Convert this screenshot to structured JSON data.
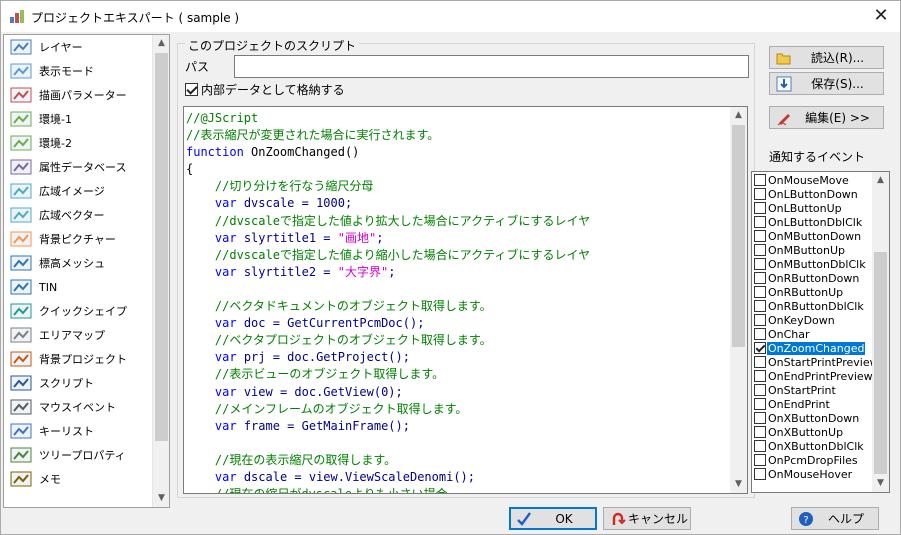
{
  "window": {
    "title": "プロジェクトエキスパート ( sample )"
  },
  "nav": {
    "items": [
      {
        "label": "レイヤー",
        "icon": "layer-icon"
      },
      {
        "label": "表示モード",
        "icon": "display-mode-icon"
      },
      {
        "label": "描画パラメーター",
        "icon": "draw-params-icon"
      },
      {
        "label": "環境-1",
        "icon": "environment-icon"
      },
      {
        "label": "環境-2",
        "icon": "environment-icon"
      },
      {
        "label": "属性データベース",
        "icon": "attribute-db-icon"
      },
      {
        "label": "広域イメージ",
        "icon": "wide-image-icon"
      },
      {
        "label": "広域ベクター",
        "icon": "wide-vector-icon"
      },
      {
        "label": "背景ピクチャー",
        "icon": "background-picture-icon"
      },
      {
        "label": "標高メッシュ",
        "icon": "elevation-mesh-icon"
      },
      {
        "label": "TIN",
        "icon": "tin-icon"
      },
      {
        "label": "クイックシェイプ",
        "icon": "quick-shape-icon"
      },
      {
        "label": "エリアマップ",
        "icon": "area-map-icon"
      },
      {
        "label": "背景プロジェクト",
        "icon": "background-project-icon"
      },
      {
        "label": "スクリプト",
        "icon": "script-icon",
        "selected": true
      },
      {
        "label": "マウスイベント",
        "icon": "mouse-icon"
      },
      {
        "label": "キーリスト",
        "icon": "key-list-icon"
      },
      {
        "label": "ツリープロパティ",
        "icon": "tree-property-icon"
      },
      {
        "label": "メモ",
        "icon": "memo-icon"
      }
    ]
  },
  "script_group": {
    "legend": "このプロジェクトのスクリプト",
    "path_label": "パス",
    "path_value": "",
    "store_internal_label": "内部データとして格納する",
    "store_internal_checked": true
  },
  "code": [
    [
      [
        "//@JScript",
        "green"
      ]
    ],
    [
      [
        "//表示縮尺が変更された場合に実行されます。",
        "green"
      ]
    ],
    [
      [
        "function",
        "blue"
      ],
      [
        " OnZoomChanged()",
        "black"
      ]
    ],
    [
      [
        "{",
        "black"
      ]
    ],
    [
      [
        "    //切り分けを行なう縮尺分母",
        "green"
      ]
    ],
    [
      [
        "    ",
        "black"
      ],
      [
        "var",
        "blue"
      ],
      [
        " dvscale = ",
        "darkblue"
      ],
      [
        "1000",
        "darkblue"
      ],
      [
        ";",
        "darkblue"
      ]
    ],
    [
      [
        "    //dvscaleで指定した値より拡大した場合にアクティブにするレイヤ",
        "green"
      ]
    ],
    [
      [
        "    ",
        "black"
      ],
      [
        "var",
        "blue"
      ],
      [
        " slyrtitle1 = ",
        "darkblue"
      ],
      [
        "\"画地\"",
        "magenta"
      ],
      [
        ";",
        "darkblue"
      ]
    ],
    [
      [
        "    //dvscaleで指定した値より縮小した場合にアクティブにするレイヤ",
        "green"
      ]
    ],
    [
      [
        "    ",
        "black"
      ],
      [
        "var",
        "blue"
      ],
      [
        " slyrtitle2 = ",
        "darkblue"
      ],
      [
        "\"大字界\"",
        "magenta"
      ],
      [
        ";",
        "darkblue"
      ]
    ],
    [
      [
        "",
        "black"
      ]
    ],
    [
      [
        "    //ベクタドキュメントのオブジェクト取得します。",
        "green"
      ]
    ],
    [
      [
        "    ",
        "black"
      ],
      [
        "var",
        "blue"
      ],
      [
        " doc = GetCurrentPcmDoc();",
        "darkblue"
      ]
    ],
    [
      [
        "    //ベクタプロジェクトのオブジェクト取得します。",
        "green"
      ]
    ],
    [
      [
        "    ",
        "black"
      ],
      [
        "var",
        "blue"
      ],
      [
        " prj = doc.GetProject();",
        "darkblue"
      ]
    ],
    [
      [
        "    //表示ビューのオブジェクト取得します。",
        "green"
      ]
    ],
    [
      [
        "    ",
        "black"
      ],
      [
        "var",
        "blue"
      ],
      [
        " view = doc.GetView(0);",
        "darkblue"
      ]
    ],
    [
      [
        "    //メインフレームのオブジェクト取得します。",
        "green"
      ]
    ],
    [
      [
        "    ",
        "black"
      ],
      [
        "var",
        "blue"
      ],
      [
        " frame = GetMainFrame();",
        "darkblue"
      ]
    ],
    [
      [
        "",
        "black"
      ]
    ],
    [
      [
        "    //現在の表示縮尺の取得します。",
        "green"
      ]
    ],
    [
      [
        "    ",
        "black"
      ],
      [
        "var",
        "blue"
      ],
      [
        " dscale = view.ViewScaleDenomi();",
        "darkblue"
      ]
    ],
    [
      [
        "    //現在の縮尺がdvscaleよりも小さい場合",
        "green"
      ]
    ]
  ],
  "buttons": {
    "load": "読込(R)...",
    "save": "保存(S)...",
    "edit": "編集(E) >>",
    "ok": "OK",
    "cancel": "キャンセル",
    "help": "ヘルプ"
  },
  "events": {
    "label": "通知するイベント",
    "items": [
      {
        "name": "OnMouseMove",
        "checked": false
      },
      {
        "name": "OnLButtonDown",
        "checked": false
      },
      {
        "name": "OnLButtonUp",
        "checked": false
      },
      {
        "name": "OnLButtonDblClk",
        "checked": false
      },
      {
        "name": "OnMButtonDown",
        "checked": false
      },
      {
        "name": "OnMButtonUp",
        "checked": false
      },
      {
        "name": "OnMButtonDblClk",
        "checked": false
      },
      {
        "name": "OnRButtonDown",
        "checked": false
      },
      {
        "name": "OnRButtonUp",
        "checked": false
      },
      {
        "name": "OnRButtonDblClk",
        "checked": false
      },
      {
        "name": "OnKeyDown",
        "checked": false
      },
      {
        "name": "OnChar",
        "checked": false
      },
      {
        "name": "OnZoomChanged",
        "checked": true,
        "selected": true
      },
      {
        "name": "OnStartPrintPreview",
        "checked": false
      },
      {
        "name": "OnEndPrintPreview",
        "checked": false
      },
      {
        "name": "OnStartPrint",
        "checked": false
      },
      {
        "name": "OnEndPrint",
        "checked": false
      },
      {
        "name": "OnXButtonDown",
        "checked": false
      },
      {
        "name": "OnXButtonUp",
        "checked": false
      },
      {
        "name": "OnXButtonDblClk",
        "checked": false
      },
      {
        "name": "OnPcmDropFiles",
        "checked": false
      },
      {
        "name": "OnMouseHover",
        "checked": false
      }
    ]
  },
  "colors": {
    "comment": "#008000",
    "keyword": "#0000ff",
    "string": "#d000d0",
    "selection": "#0078d7"
  }
}
